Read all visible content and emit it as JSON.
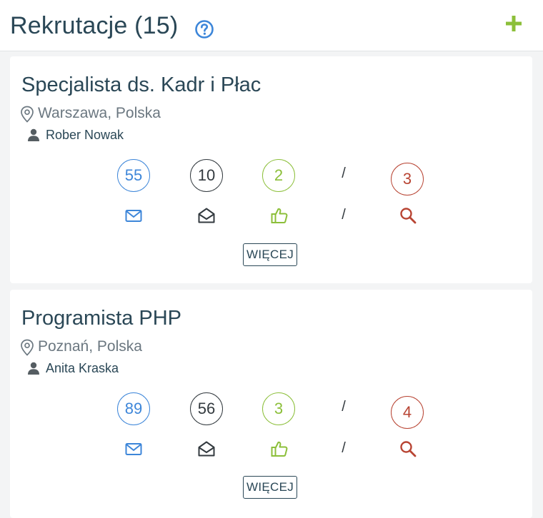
{
  "header": {
    "title": "Rekrutacje (15)",
    "help_icon": "question-circle-icon",
    "add_icon": "plus-icon"
  },
  "colors": {
    "title": "#2a4756",
    "blue": "#3d86d9",
    "dark": "#333a3f",
    "green": "#8cbf3a",
    "red": "#b84433"
  },
  "recruitments": [
    {
      "title": "Specjalista ds. Kadr i Płac",
      "location": "Warszawa, Polska",
      "recruiter": "Rober Nowak",
      "stats": {
        "received": "55",
        "read": "10",
        "liked": "2",
        "separator": "/",
        "searched": "3"
      },
      "more_label": "WIĘCEJ"
    },
    {
      "title": "Programista PHP",
      "location": "Poznań, Polska",
      "recruiter": "Anita Kraska",
      "stats": {
        "received": "89",
        "read": "56",
        "liked": "3",
        "separator": "/",
        "searched": "4"
      },
      "more_label": "WIĘCEJ"
    }
  ]
}
